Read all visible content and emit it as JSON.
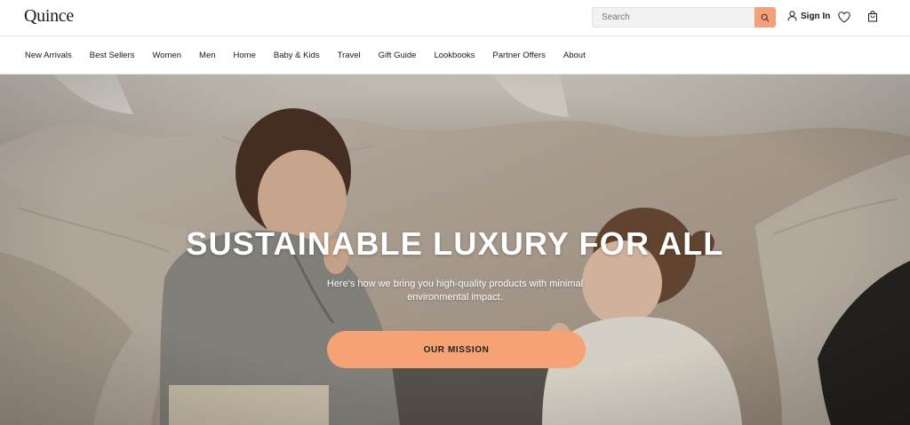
{
  "header": {
    "logo": "Quince",
    "search_placeholder": "Search",
    "search_button_icon": "search-icon",
    "sign_in": "Sign In",
    "sign_in_icon": "user-icon",
    "wishlist_icon": "heart-icon",
    "cart_icon": "bag-icon"
  },
  "nav": {
    "items": [
      {
        "label": "New Arrivals"
      },
      {
        "label": "Best Sellers"
      },
      {
        "label": "Women"
      },
      {
        "label": "Men"
      },
      {
        "label": "Home"
      },
      {
        "label": "Baby & Kids"
      },
      {
        "label": "Travel"
      },
      {
        "label": "Gift Guide"
      },
      {
        "label": "Lookbooks"
      },
      {
        "label": "Partner Offers"
      },
      {
        "label": "About"
      }
    ]
  },
  "hero": {
    "title": "SUSTAINABLE LUXURY FOR ALL",
    "subtitle": "Here's how we bring you high-quality products with minimal environmental impact.",
    "cta": "OUR MISSION"
  },
  "colors": {
    "accent": "#f6a274",
    "search_button": "#f4a07a",
    "text": "#1a1a1a"
  }
}
